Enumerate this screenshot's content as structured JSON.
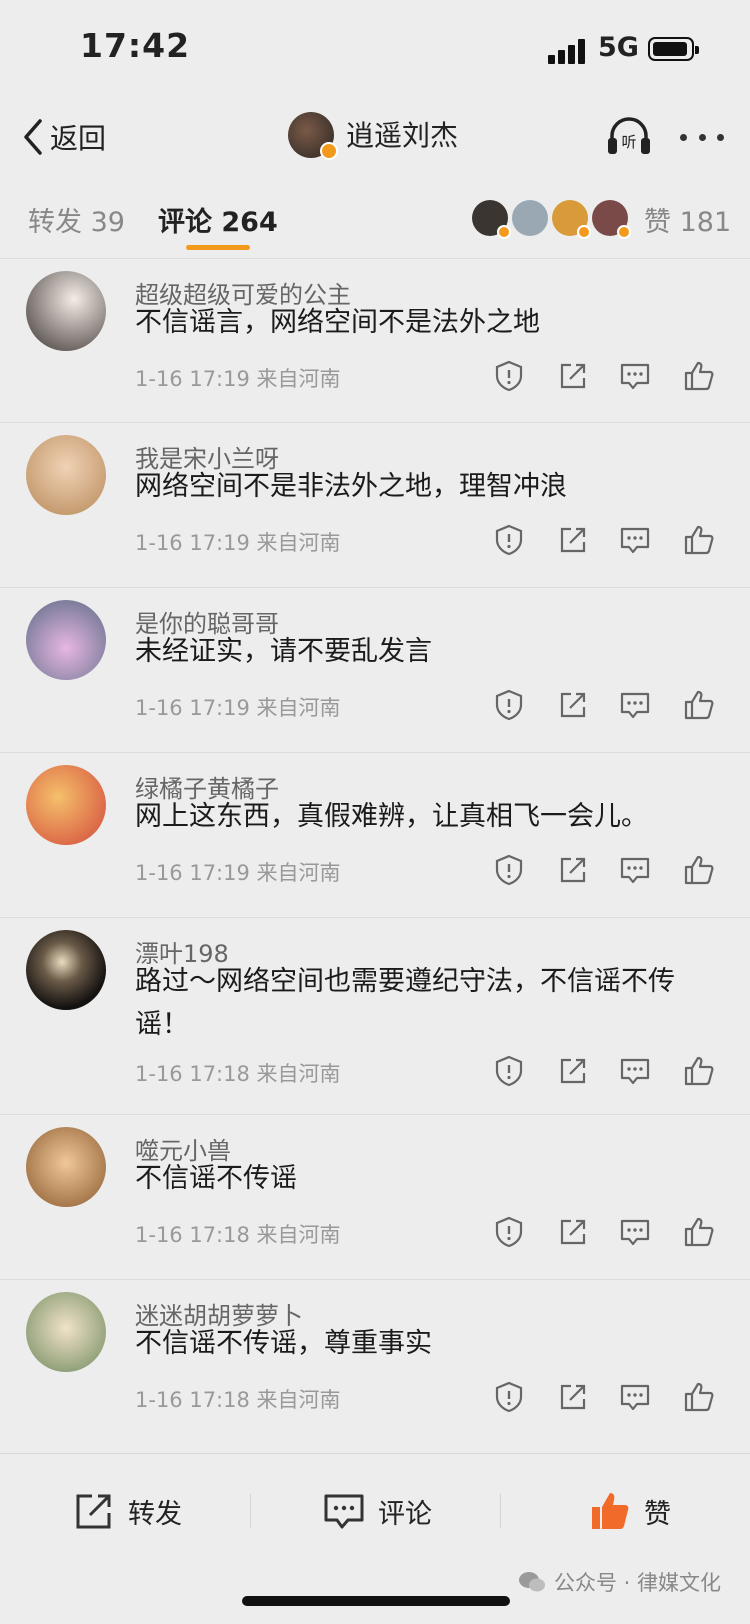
{
  "status_bar": {
    "time": "17:42",
    "network": "5G"
  },
  "nav": {
    "back_label": "返回",
    "author": "逍遥刘杰",
    "listen_label": "听"
  },
  "tabs": {
    "repost": "转发 39",
    "comments": "评论 264",
    "likes": "赞 181"
  },
  "comments": [
    {
      "name": "超级超级可爱的公主",
      "text": "不信谣言，网络空间不是法外之地",
      "time": "1-16 17:19",
      "location": "来自河南",
      "avatar_color": "#d8cfc6"
    },
    {
      "name": "我是宋小兰呀",
      "text": "网络空间不是非法外之地，理智冲浪",
      "time": "1-16 17:19",
      "location": "来自河南",
      "avatar_color": "#d9b48c"
    },
    {
      "name": "是你的聪哥哥",
      "text": "未经证实，请不要乱发言",
      "time": "1-16 17:19",
      "location": "来自河南",
      "avatar_color": "#c99ac7"
    },
    {
      "name": "绿橘子黄橘子",
      "text": "网上这东西，真假难辨，让真相飞一会儿。",
      "time": "1-16 17:19",
      "location": "来自河南",
      "avatar_color": "#e0705a"
    },
    {
      "name": "漂叶198",
      "text": "路过～网络空间也需要遵纪守法，不信谣不传谣！",
      "time": "1-16 17:18",
      "location": "来自河南",
      "avatar_color": "#2a2520"
    },
    {
      "name": "噬元小兽",
      "text": "不信谣不传谣",
      "time": "1-16 17:18",
      "location": "来自河南",
      "avatar_color": "#b8854e"
    },
    {
      "name": "迷迷胡胡萝萝卜",
      "text": "不信谣不传谣，尊重事实",
      "time": "1-16 17:18",
      "location": "来自河南",
      "avatar_color": "#8aa07a"
    }
  ],
  "bottom_bar": {
    "repost": "转发",
    "comment": "评论",
    "like": "赞"
  },
  "watermark": "公众号 · 律媒文化",
  "colors": {
    "accent": "#f39a1c",
    "like_active": "#f26a2a",
    "background": "#ededed"
  }
}
